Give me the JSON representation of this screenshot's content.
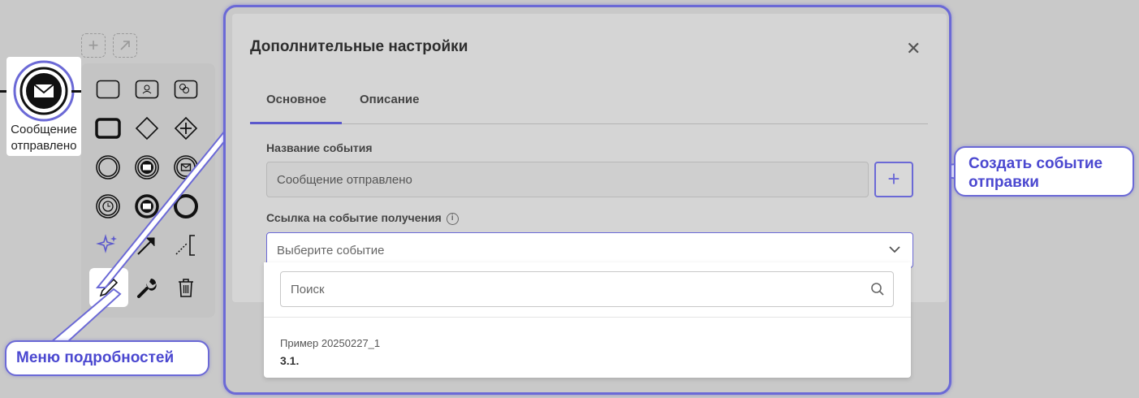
{
  "modal": {
    "title": "Дополнительные настройки",
    "tabs": [
      "Основное",
      "Описание"
    ],
    "active_tab": 0,
    "field_event_name_label": "Название события",
    "field_event_name_value": "Сообщение отправлено",
    "field_link_label": "Ссылка на событие получения",
    "select_placeholder": "Выберите событие",
    "search_placeholder": "Поиск",
    "options": [
      {
        "subtitle": "Пример 20250227_1",
        "title": "3.1."
      }
    ]
  },
  "canvas": {
    "event_label": "Сообщение отправлено"
  },
  "callouts": {
    "create_event": "Создать событие отправки",
    "details_menu": "Меню подробностей"
  },
  "colors": {
    "accent": "#6b69d6"
  }
}
